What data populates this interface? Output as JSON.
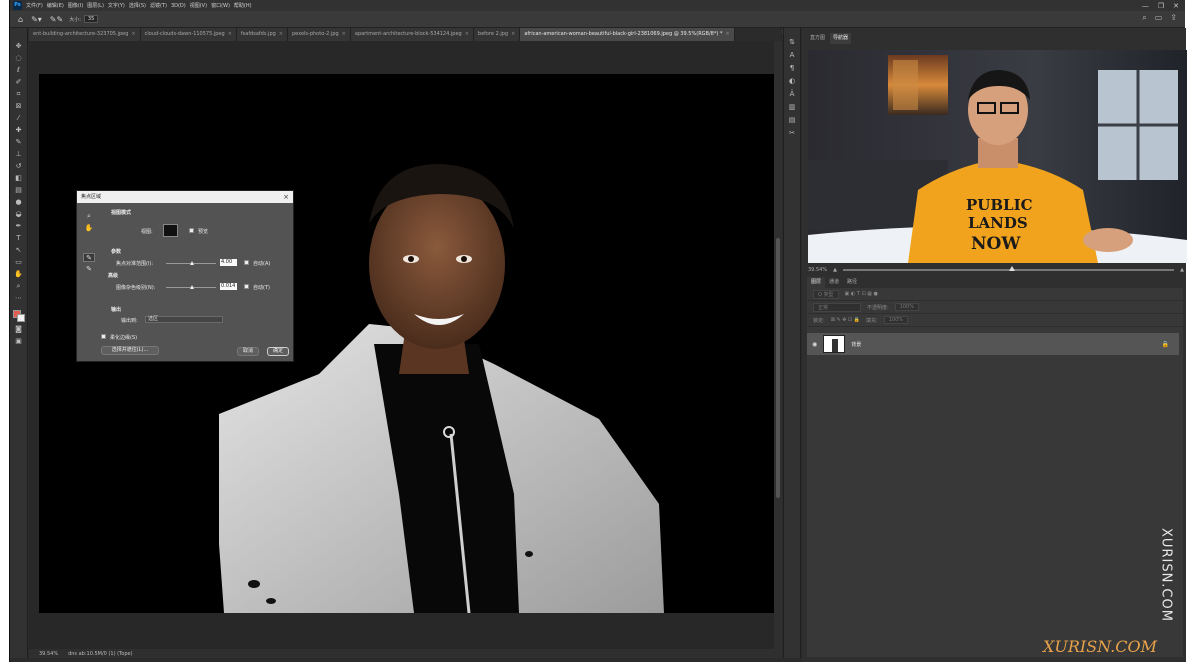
{
  "menu": {
    "logo": "Ps",
    "items": [
      "文件(F)",
      "编辑(E)",
      "图像(I)",
      "图层(L)",
      "文字(Y)",
      "选择(S)",
      "滤镜(T)",
      "3D(D)",
      "视图(V)",
      "窗口(W)",
      "帮助(H)"
    ],
    "window_controls": [
      "—",
      "❐",
      "✕"
    ]
  },
  "options": {
    "size_label": "大小:",
    "size_value": "35"
  },
  "tabs": [
    {
      "label": "ent-building-architecture-323705.jpeg",
      "active": false
    },
    {
      "label": "cloud-clouds-dawn-110575.jpeg",
      "active": false
    },
    {
      "label": "fsafdsafds.jpg",
      "active": false
    },
    {
      "label": "pexels-photo-2.jpg",
      "active": false
    },
    {
      "label": "apartment-architecture-block-534124.jpeg",
      "active": false
    },
    {
      "label": "before 2.jpg",
      "active": false
    },
    {
      "label": "african-american-woman-beautiful-black-girl-2381069.jpeg @ 39.5%(RGB/8*) *",
      "active": true
    }
  ],
  "status": {
    "zoom": "39.54%",
    "doc": "dns ab:10.5M/0 (1) (Tope)"
  },
  "dialog": {
    "title": "焦点区域",
    "view_mode_heading": "视图模式",
    "view_label": "视图:",
    "preview_label": "预览",
    "params_heading": "参数",
    "focus_range_label": "焦点对准范围(I):",
    "focus_range_value": "4.00",
    "auto_a_label": "自动(A)",
    "advanced_heading": "高级",
    "noise_label": "图像杂色级别(N):",
    "noise_value": "0.014",
    "auto_t_label": "自动(T)",
    "output_heading": "输出",
    "output_to_label": "输出到:",
    "output_to_value": "选区",
    "soften_label": "柔化边缘(S)",
    "select_and_mask_label": "选择并遮住(L)...",
    "cancel_label": "取消",
    "ok_label": "确定"
  },
  "right_panel": {
    "nav_tabs": [
      "直方图",
      "导航器"
    ],
    "nav_zoom": "39.54%",
    "layer_tabs": [
      "图层",
      "通道",
      "路径"
    ],
    "filter_placeholder": "Q 类型",
    "blend_mode": "正常",
    "opacity_label": "不透明度:",
    "opacity_value": "100%",
    "lock_label": "锁定:",
    "fill_label": "填充:",
    "fill_value": "100%",
    "layer_name": "背景"
  },
  "video": {
    "shirt_text": [
      "PUBLIC",
      "LANDS",
      "NOW"
    ]
  },
  "watermark": {
    "vertical": "XURISN.COM",
    "logo": "XURISN.COM"
  },
  "colors": {
    "foreground": "#e55b4d",
    "background": "#f2f2f2",
    "app_bg": "#2b2b2b",
    "shirt": "#f2a31d",
    "watermark_logo": "#e9a24a"
  }
}
